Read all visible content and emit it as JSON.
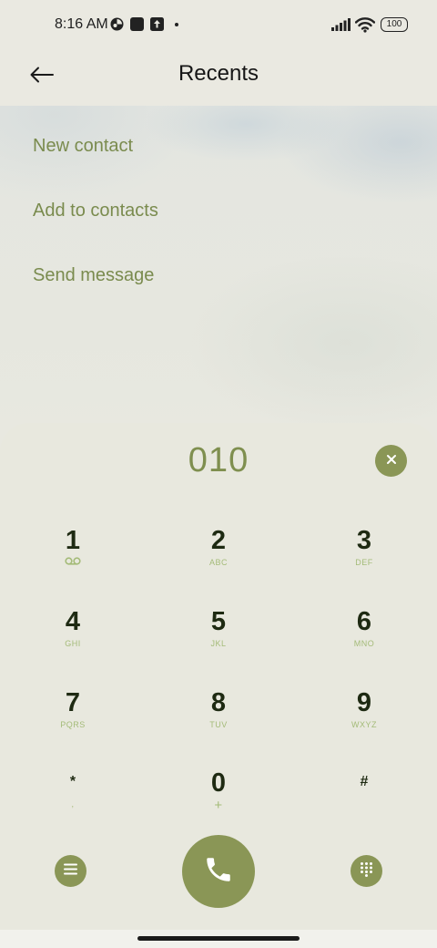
{
  "status_bar": {
    "time": "8:16 AM",
    "battery": "100"
  },
  "header": {
    "title": "Recents",
    "back_icon": "arrow-left-icon"
  },
  "actions": [
    {
      "label": "New contact"
    },
    {
      "label": "Add to contacts"
    },
    {
      "label": "Send message"
    }
  ],
  "dialer": {
    "number": "010",
    "clear_icon": "close-icon",
    "keys": [
      {
        "digit": "1",
        "letters": ""
      },
      {
        "digit": "2",
        "letters": "ABC"
      },
      {
        "digit": "3",
        "letters": "DEF"
      },
      {
        "digit": "4",
        "letters": "GHI"
      },
      {
        "digit": "5",
        "letters": "JKL"
      },
      {
        "digit": "6",
        "letters": "MNO"
      },
      {
        "digit": "7",
        "letters": "PQRS"
      },
      {
        "digit": "8",
        "letters": "TUV"
      },
      {
        "digit": "9",
        "letters": "WXYZ"
      },
      {
        "digit": "*",
        "letters": ","
      },
      {
        "digit": "0",
        "letters": "+"
      },
      {
        "digit": "#",
        "letters": ""
      }
    ]
  },
  "colors": {
    "accent": "#8a9656",
    "accent_text": "#7a8b4e",
    "key_digit": "#1e2a12",
    "key_letters": "#a4bb78",
    "dialer_bg": "#e8e8de"
  },
  "icons": {
    "menu": "menu-icon",
    "call": "phone-icon",
    "dialpad": "dialpad-icon",
    "voicemail": "voicemail-icon"
  }
}
